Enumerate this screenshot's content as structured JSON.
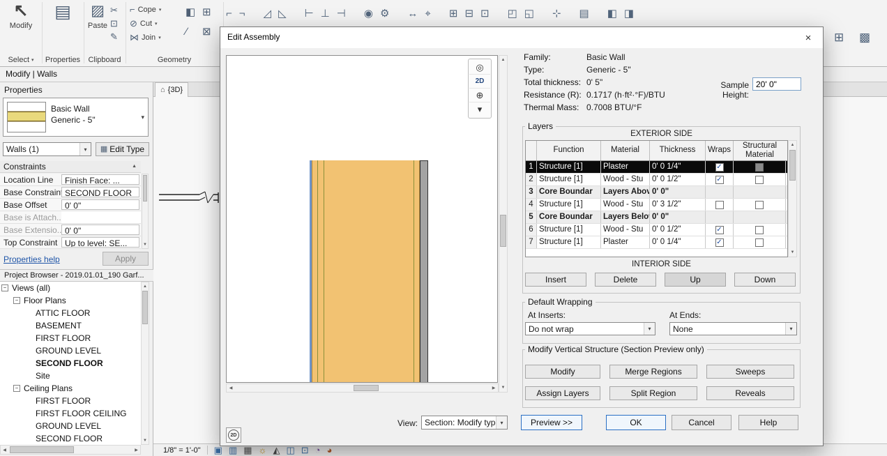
{
  "icons": {
    "modify_cursor": "↖",
    "properties_big": "▤",
    "paste_big": "▨",
    "scissors": "✂",
    "copy": "⊡",
    "match_type": "✎",
    "cope": "⌐",
    "cut_geometry": "⊘",
    "join": "⋈",
    "paint": "◧",
    "split": "∕",
    "demolish": "⊠",
    "wall_joins": "⊞",
    "edit_type": "▦",
    "dropdown_arrow": "▾",
    "up_arrow": "▲",
    "down_arrow": "▼",
    "left_arrow": "◀",
    "right_arrow": "▶",
    "collapse": "−",
    "check": "✓",
    "close": "×",
    "view_tab": "⌂",
    "nav_wheel": "◎",
    "nav_2d": "2D",
    "zoom_in": "⊕",
    "chevron_down": "▾",
    "preview_2d": "2D"
  },
  "ribbon": {
    "modify_label": "Modify",
    "select_label": "Select",
    "properties_label": "Properties",
    "paste_label": "Paste",
    "clipboard_label": "Clipboard",
    "cope_label": "Cope",
    "cut_label": "Cut",
    "join_label": "Join",
    "geometry_label": "Geometry",
    "top_icon_clusters": [
      [
        {
          "name": "cope-tool-icon",
          "glyph": "⌐"
        },
        {
          "name": "opening-tool-icon",
          "glyph": "¬"
        }
      ],
      [
        {
          "name": "slope-tool-icon",
          "glyph": "◿"
        },
        {
          "name": "ramp-tool-icon",
          "glyph": "◺"
        }
      ],
      [
        {
          "name": "join-elements-icon",
          "glyph": "⊢"
        },
        {
          "name": "unjoin-elements-icon",
          "glyph": "⊥"
        },
        {
          "name": "beam-wall-join-icon",
          "glyph": "⊣"
        }
      ],
      [
        {
          "name": "spot-elevation-icon",
          "glyph": "◉"
        },
        {
          "name": "settings-gear-icon",
          "glyph": "⚙"
        }
      ],
      [
        {
          "name": "measure-icon",
          "glyph": "↔"
        },
        {
          "name": "aligned-dimension-icon",
          "glyph": "⌖"
        }
      ],
      [
        {
          "name": "create-group-icon",
          "glyph": "⊞"
        },
        {
          "name": "create-assembly-icon",
          "glyph": "⊟"
        },
        {
          "name": "create-parts-icon",
          "glyph": "⊡"
        }
      ],
      [
        {
          "name": "solid-display-icon",
          "glyph": "◰"
        },
        {
          "name": "section-box-icon",
          "glyph": "◱"
        }
      ],
      [
        {
          "name": "pin-icon",
          "glyph": "⊹"
        }
      ],
      [
        {
          "name": "schedule-icon",
          "glyph": "▤"
        }
      ],
      [
        {
          "name": "load-family-icon",
          "glyph": "◧"
        },
        {
          "name": "insert-component-icon",
          "glyph": "◨"
        }
      ]
    ],
    "right_icons": [
      {
        "name": "link-revit-icon",
        "glyph": "⊞"
      },
      {
        "name": "manage-links-icon",
        "glyph": "▩"
      }
    ]
  },
  "modebar": {
    "title": "Modify | Walls"
  },
  "canvas": {
    "view_tab_label": "{3D}",
    "scale_label": "1/8\" = 1'-0\"",
    "status_icons": [
      {
        "name": "view-scale-icon",
        "glyph": "▣",
        "color": "#3b6ea5"
      },
      {
        "name": "detail-level-icon",
        "glyph": "▥",
        "color": "#3b6ea5"
      },
      {
        "name": "visual-style-icon",
        "glyph": "▦",
        "color": "#555555"
      },
      {
        "name": "sun-path-icon",
        "glyph": "☼",
        "color": "#c9941f"
      },
      {
        "name": "shadows-icon",
        "glyph": "◭",
        "color": "#4a4a4a"
      },
      {
        "name": "crop-view-icon",
        "glyph": "◫",
        "color": "#3b6ea5"
      },
      {
        "name": "show-crop-icon",
        "glyph": "⊡",
        "color": "#3b6ea5"
      },
      {
        "name": "temporary-hide-icon",
        "glyph": "◔",
        "color": "#7a4fa0"
      },
      {
        "name": "reveal-hidden-icon",
        "glyph": "◕",
        "color": "#b05a2a"
      }
    ]
  },
  "properties": {
    "title": "Properties",
    "type_selector": {
      "name": "Basic Wall",
      "desc": "Generic - 5\""
    },
    "filter_value": "Walls (1)",
    "edit_type_label": "Edit Type",
    "group_header": "Constraints",
    "rows": [
      {
        "label": "Location Line",
        "value": "Finish Face: ...",
        "boxed": true
      },
      {
        "label": "Base Constraint",
        "value": "SECOND FLOOR",
        "boxed": true
      },
      {
        "label": "Base Offset",
        "value": "0' 0\"",
        "boxed": true
      },
      {
        "label": "Base is Attach...",
        "value": "",
        "dim": true
      },
      {
        "label": "Base Extensio...",
        "value": "0' 0\"",
        "dim": true,
        "boxed": true
      },
      {
        "label": "Top Constraint",
        "value": "Up to level: SE...",
        "boxed": true
      }
    ],
    "help_link": "Properties help",
    "apply_label": "Apply"
  },
  "project_browser": {
    "title": "Project Browser - 2019.01.01_190 Garf...",
    "items": [
      {
        "label": "Views (all)",
        "level": 0,
        "expander": true
      },
      {
        "label": "Floor Plans",
        "level": 1,
        "expander": true
      },
      {
        "label": "ATTIC FLOOR",
        "level": 2
      },
      {
        "label": "BASEMENT",
        "level": 2
      },
      {
        "label": "FIRST FLOOR",
        "level": 2
      },
      {
        "label": "GROUND LEVEL",
        "level": 2
      },
      {
        "label": "SECOND FLOOR",
        "level": 2,
        "bold": true
      },
      {
        "label": "Site",
        "level": 2
      },
      {
        "label": "Ceiling Plans",
        "level": 1,
        "expander": true
      },
      {
        "label": "FIRST FLOOR",
        "level": 2
      },
      {
        "label": "FIRST FLOOR CEILING",
        "level": 2
      },
      {
        "label": "GROUND LEVEL",
        "level": 2
      },
      {
        "label": "SECOND FLOOR",
        "level": 2
      }
    ]
  },
  "dialog": {
    "title": "Edit Assembly",
    "info": [
      {
        "label": "Family:",
        "value": "Basic Wall"
      },
      {
        "label": "Type:",
        "value": "Generic - 5\""
      },
      {
        "label": "Total thickness:",
        "value": "0' 5\""
      },
      {
        "label": "Resistance (R):",
        "value": "0.1717 (h·ft²·°F)/BTU"
      },
      {
        "label": "Thermal Mass:",
        "value": "0.7008 BTU/°F"
      }
    ],
    "sample_height_label": "Sample Height:",
    "sample_height_value": "20' 0\"",
    "layers": {
      "group_label": "Layers",
      "exterior_label": "EXTERIOR SIDE",
      "interior_label": "INTERIOR SIDE",
      "columns": [
        "",
        "Function",
        "Material",
        "Thickness",
        "Wraps",
        "Structural Material"
      ],
      "rows": [
        {
          "num": "1",
          "function": "Structure [1]",
          "material": "Plaster",
          "thickness": "0' 0 1/4\"",
          "wraps": "checked",
          "structural": "dark",
          "state": "selected"
        },
        {
          "num": "2",
          "function": "Structure [1]",
          "material": "Wood - Stu",
          "thickness": "0' 0 1/2\"",
          "wraps": "checked",
          "structural": "unchecked",
          "state": ""
        },
        {
          "num": "3",
          "function": "Core Boundar",
          "material": "Layers Above",
          "thickness": "0' 0\"",
          "wraps": "none",
          "structural": "none",
          "state": "core"
        },
        {
          "num": "4",
          "function": "Structure [1]",
          "material": "Wood - Stu",
          "thickness": "0' 3 1/2\"",
          "wraps": "unchecked",
          "structural": "unchecked",
          "state": ""
        },
        {
          "num": "5",
          "function": "Core Boundar",
          "material": "Layers Below",
          "thickness": "0' 0\"",
          "wraps": "none",
          "structural": "none",
          "state": "core"
        },
        {
          "num": "6",
          "function": "Structure [1]",
          "material": "Wood - Stu",
          "thickness": "0' 0 1/2\"",
          "wraps": "checked",
          "structural": "unchecked",
          "state": ""
        },
        {
          "num": "7",
          "function": "Structure [1]",
          "material": "Plaster",
          "thickness": "0' 0 1/4\"",
          "wraps": "checked",
          "structural": "unchecked",
          "state": ""
        }
      ],
      "buttons": [
        "Insert",
        "Delete",
        "Up",
        "Down"
      ]
    },
    "default_wrapping": {
      "group_label": "Default Wrapping",
      "at_inserts_label": "At Inserts:",
      "at_inserts_value": "Do not wrap",
      "at_ends_label": "At Ends:",
      "at_ends_value": "None"
    },
    "modify_vertical": {
      "group_label": "Modify Vertical Structure (Section Preview only)",
      "buttons": [
        "Modify",
        "Merge Regions",
        "Sweeps",
        "Assign Layers",
        "Split Region",
        "Reveals"
      ]
    },
    "preview_toolbar": [
      {
        "name": "steering-wheel-icon",
        "glyph": "◎"
      },
      {
        "name": "view-cube-2d-icon",
        "glyph": "2D"
      },
      {
        "name": "zoom-icon",
        "glyph": "⊕"
      },
      {
        "name": "toolbar-chevron-icon",
        "glyph": "▾"
      }
    ],
    "view_label": "View:",
    "view_value": "Section: Modify type",
    "preview_label": "Preview >>",
    "ok_label": "OK",
    "cancel_label": "Cancel",
    "help_label": "Help"
  }
}
